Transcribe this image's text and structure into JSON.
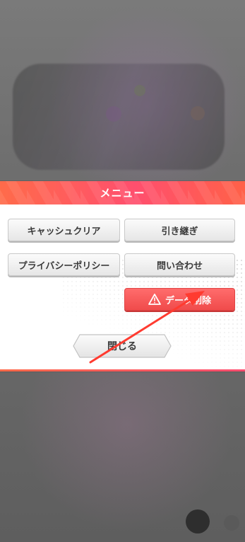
{
  "dialog": {
    "title": "メニュー",
    "buttons": {
      "cache_clear": "キャッシュクリア",
      "transfer": "引き継ぎ",
      "privacy_policy": "プライバシーポリシー",
      "contact": "問い合わせ",
      "delete_data": "データ削除",
      "close": "閉じる"
    }
  },
  "icons": {
    "warning": "warning-triangle-icon",
    "annotation": "red-arrow"
  },
  "colors": {
    "header_start": "#ff6b4a",
    "header_end": "#ff4f6e",
    "danger": "#f04b4b",
    "annotation": "#ff3b30"
  }
}
